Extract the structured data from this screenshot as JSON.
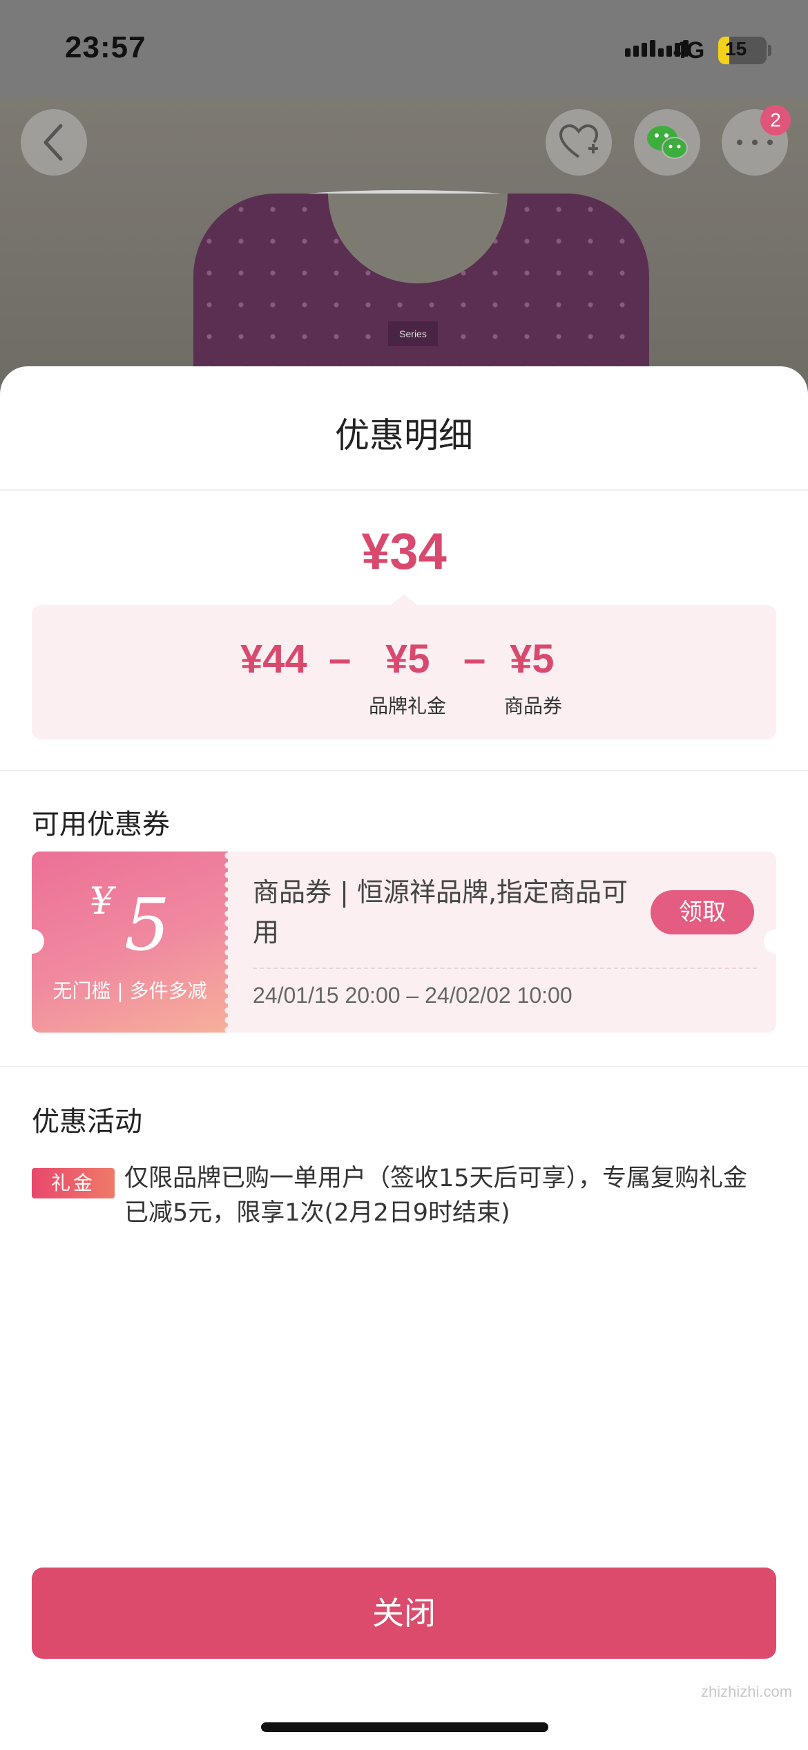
{
  "status_bar": {
    "time": "23:57",
    "network": "4G",
    "battery": "15",
    "battery_level_percent": 15
  },
  "product": {
    "tag_text": "Series",
    "more_badge": "2"
  },
  "icons": {
    "back": "chevron-left-icon",
    "favorite": "heart-plus-icon",
    "wechat": "wechat-icon",
    "more": "more-dots-icon"
  },
  "sheet": {
    "title": "优惠明细",
    "final_price": "¥34",
    "breakdown": {
      "original": "¥44",
      "minus1": "–",
      "brand_gift": "¥5",
      "brand_gift_label": "品牌礼金",
      "minus2": "–",
      "coupon": "¥5",
      "coupon_label": "商品券"
    },
    "coupons_section_title": "可用优惠券",
    "coupon": {
      "currency": "¥",
      "amount": "5",
      "condition": "无门槛 | 多件多减",
      "description": "商品券 | 恒源祥品牌,指定商品可用",
      "validity": "24/01/15 20:00 – 24/02/02 10:00",
      "claim_label": "领取"
    },
    "activity_section_title": "优惠活动",
    "activity": {
      "tag": "礼金",
      "text": "仅限品牌已购一单用户（签收15天后可享），专属复购礼金已减5元，限享1次(2月2日9时结束)"
    },
    "close_label": "关闭"
  },
  "watermark": "zhizhizhi.com",
  "colors": {
    "accent": "#d9496e",
    "button": "#dd4b6c",
    "panel": "#fbeff2"
  }
}
